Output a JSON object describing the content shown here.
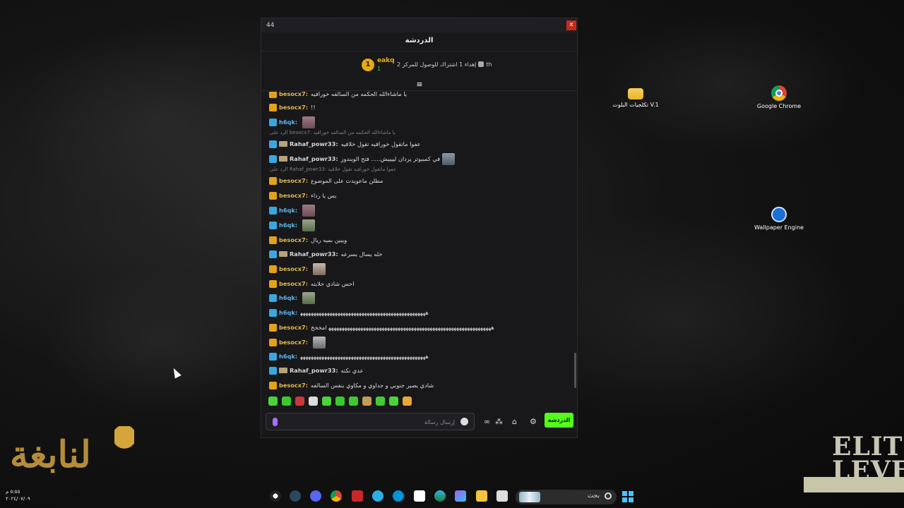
{
  "desktop": {
    "icons": [
      {
        "label": "تكلجيات البلوت V.1"
      },
      {
        "label": "Google Chrome"
      },
      {
        "label": "Wallpaper Engine"
      }
    ]
  },
  "window": {
    "title_number": "44",
    "close_label": "x"
  },
  "chat": {
    "header": "الدردشة",
    "pinned": {
      "rank": "1",
      "username": "eakq",
      "count": "1",
      "goal_text": "إهداء 1 اشتراك للوصول للمركز 2",
      "goal_suffix": "th"
    },
    "messages": [
      {
        "type": "crown",
        "user": "besocx7:",
        "text": "يا ماشاءالله الحكمه من السالفه خورافيه"
      },
      {
        "type": "crown",
        "user": "besocx7:",
        "text": "!!"
      },
      {
        "type": "arrow",
        "user": "h6qk:",
        "text": "",
        "emote": "em1"
      },
      {
        "type": "reply",
        "text": "الرد على besocx7: يا ماشاءالله الحكمه من السالفه خورافيه"
      },
      {
        "type": "arrow-sub",
        "user": "Rahaf_powr33:",
        "text": "عفوا ماتقول خورافيه تقول خلافيه"
      },
      {
        "type": "arrow-sub",
        "user": "Rahaf_powr33:",
        "text": "في كمبيوتر يردان لييييش..... فتح الويندوز",
        "emote": "em4"
      },
      {
        "type": "reply",
        "text": "الرد على Rahaf_powr33: عفوا ماتقول خورافيه تقول خلافيه"
      },
      {
        "type": "crown",
        "user": "besocx7:",
        "text": "مطلن ماعويدت على الموضوع"
      },
      {
        "type": "crown",
        "user": "besocx7:",
        "text": "بس يا رداء"
      },
      {
        "type": "arrow",
        "user": "h6qk:",
        "text": "",
        "emote": "em1"
      },
      {
        "type": "arrow",
        "user": "h6qk:",
        "text": "",
        "emote": "em2"
      },
      {
        "type": "crown",
        "user": "besocx7:",
        "text": "ويبين بميه ريال"
      },
      {
        "type": "arrow-sub",
        "user": "Rahaf_powr33:",
        "text": "خله يسال بسرعه"
      },
      {
        "type": "crown",
        "user": "besocx7:",
        "text": "",
        "emote": "em3"
      },
      {
        "type": "crown",
        "user": "besocx7:",
        "text": "احس شادي حلايته"
      },
      {
        "type": "arrow",
        "user": "h6qk:",
        "text": "",
        "emote": "em2"
      },
      {
        "type": "arrow",
        "user": "h6qk:",
        "text": "ﻫﻬﻬﻬﻬﻬﻬﻬﻬﻬﻬﻬﻬﻬﻬﻬﻬﻬﻬﻬﻬﻬﻬﻬﻬﻬﻬﻬﻬﻬﻬﻬﻬﻬﻬﻬﻬﻬﻬﻬﻬﻬﻬﻬﻬﻬﻬﻬ"
      },
      {
        "type": "crown",
        "user": "besocx7:",
        "text": "ﻫﻬﻬﻬﻬﻬﻬﻬﻬﻬﻬﻬﻬﻬﻬﻬﻬﻬﻬﻬﻬﻬﻬﻬﻬﻬﻬﻬﻬﻬﻬﻬﻬﻬﻬﻬﻬﻬﻬﻬﻬﻬﻬﻬﻬﻬﻬﻬﻬﻬﻬﻬﻬﻬﻬﻬﻬﻬﻬﻬﻬﻬ امخخخ"
      },
      {
        "type": "crown",
        "user": "besocx7:",
        "text": "",
        "emote": "em5"
      },
      {
        "type": "arrow",
        "user": "h6qk:",
        "text": "ﻫﻬﻬﻬﻬﻬﻬﻬﻬﻬﻬﻬﻬﻬﻬﻬﻬﻬﻬﻬﻬﻬﻬﻬﻬﻬﻬﻬﻬﻬﻬﻬﻬﻬﻬﻬﻬﻬﻬﻬﻬﻬﻬﻬﻬﻬﻬﻬ"
      },
      {
        "type": "arrow-sub",
        "user": "Rahaf_powr33:",
        "text": "عدي نكته"
      },
      {
        "type": "crown",
        "user": "besocx7:",
        "text": "شادي يصير جنوبي و جداوي و مكاوي بنفس السالفه"
      }
    ],
    "composer": {
      "placeholder": "إرسال رسالة",
      "send_label": "الدردشة"
    }
  },
  "taskbar": {
    "search_label": "بحث",
    "time": "٥:٥٥ م",
    "date": "٢٠٢٤/٠٧/٠٩"
  },
  "colors": {
    "accent": "#53fc18",
    "crown": "#e3a21a",
    "arrow": "#3aa7e0"
  }
}
